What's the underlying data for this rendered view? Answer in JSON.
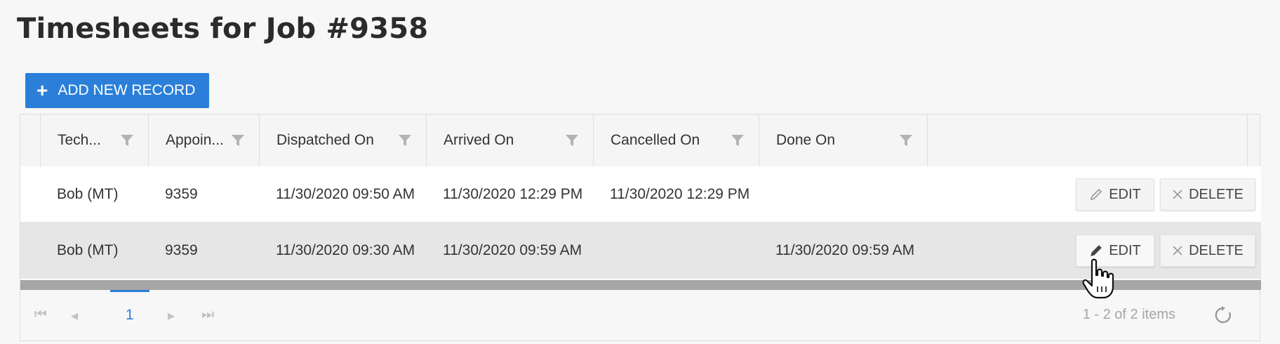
{
  "page_title": "Timesheets for Job #9358",
  "toolbar": {
    "add_label": "ADD NEW RECORD",
    "add_icon": "plus-icon"
  },
  "grid": {
    "columns": [
      "Tech...",
      "Appoin...",
      "Dispatched On",
      "Arrived On",
      "Cancelled On",
      "Done On"
    ],
    "rows": [
      {
        "tech": "Bob (MT)",
        "appointment": "9359",
        "dispatched": "11/30/2020 09:50 AM",
        "arrived": "11/30/2020 12:29 PM",
        "cancelled": "11/30/2020 12:29 PM",
        "done": ""
      },
      {
        "tech": "Bob (MT)",
        "appointment": "9359",
        "dispatched": "11/30/2020 09:30 AM",
        "arrived": "11/30/2020 09:59 AM",
        "cancelled": "",
        "done": "11/30/2020 09:59 AM"
      }
    ],
    "edit_label": "EDIT",
    "delete_label": "DELETE"
  },
  "pager": {
    "current_page": "1",
    "info": "1 - 2 of 2 items"
  },
  "colors": {
    "accent": "#2b7fd9",
    "selected_row": "#e6e6e6"
  }
}
